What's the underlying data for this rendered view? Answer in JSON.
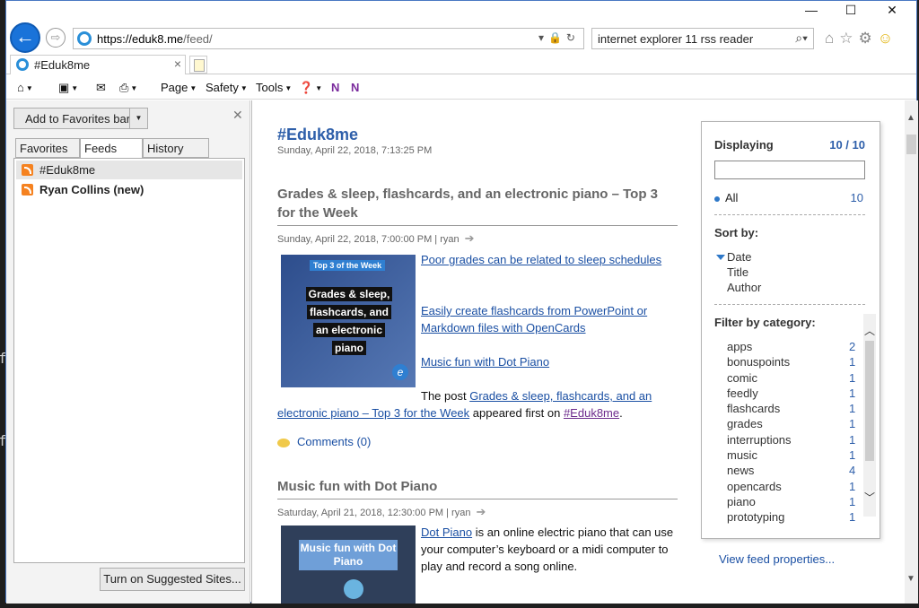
{
  "window": {
    "minimize": "—",
    "maximize": "☐",
    "close": "✕"
  },
  "address": {
    "url_prefix": "https://",
    "url_host": "eduk8.me",
    "url_path": "/feed/",
    "search_value": "internet explorer 11 rss reader"
  },
  "tab": {
    "title": "#Eduk8me",
    "close": "×"
  },
  "commandbar": {
    "page": "Page",
    "safety": "Safety",
    "tools": "Tools"
  },
  "favcenter": {
    "add_favorites": "Add to Favorites bar",
    "tabs": [
      "Favorites",
      "Feeds",
      "History"
    ],
    "feeds": [
      {
        "label": "#Eduk8me"
      },
      {
        "label": "Ryan Collins (new)"
      }
    ],
    "suggested_button": "Turn on Suggested Sites..."
  },
  "feed": {
    "title": "#Eduk8me",
    "date": "Sunday, April 22, 2018, 7:13:25 PM",
    "posts": [
      {
        "title": "Grades & sleep, flashcards, and an electronic piano – Top 3 for the Week",
        "meta": "Sunday, April 22, 2018, 7:00:00 PM | ryan",
        "thumb_banner": "Top 3 of the Week",
        "thumb_lines": [
          "Grades & sleep,",
          "flashcards, and",
          "an electronic",
          "piano"
        ],
        "links": [
          "Poor grades can be related to sleep schedules",
          "Easily create flashcards from PowerPoint or Markdown files with OpenCards",
          "Music fun with Dot Piano"
        ],
        "footer_prefix": "The post ",
        "footer_link": "Grades & sleep, flashcards, and an electronic piano – Top 3 for the Week",
        "footer_mid": " appeared first on ",
        "footer_site": "#Eduk8me",
        "footer_end": ".",
        "comments": "Comments (0)"
      },
      {
        "title": "Music fun with Dot Piano",
        "meta": "Saturday, April 21, 2018, 12:30:00 PM | ryan",
        "thumb_title": "Music fun with Dot Piano",
        "link": "Dot Piano",
        "text": " is an online electric piano that can use your computer’s keyboard or a midi computer to play and record a song online."
      }
    ]
  },
  "filter": {
    "displaying": "Displaying",
    "count": "10 / 10",
    "all_label": "All",
    "all_count": "10",
    "sort_by": "Sort by:",
    "sort_options": [
      "Date",
      "Title",
      "Author"
    ],
    "filter_by": "Filter by category:",
    "categories": [
      {
        "name": "apps",
        "count": "2"
      },
      {
        "name": "bonuspoints",
        "count": "1"
      },
      {
        "name": "comic",
        "count": "1"
      },
      {
        "name": "feedly",
        "count": "1"
      },
      {
        "name": "flashcards",
        "count": "1"
      },
      {
        "name": "grades",
        "count": "1"
      },
      {
        "name": "interruptions",
        "count": "1"
      },
      {
        "name": "music",
        "count": "1"
      },
      {
        "name": "news",
        "count": "4"
      },
      {
        "name": "opencards",
        "count": "1"
      },
      {
        "name": "piano",
        "count": "1"
      },
      {
        "name": "prototyping",
        "count": "1"
      }
    ],
    "view_properties": "View feed properties..."
  }
}
